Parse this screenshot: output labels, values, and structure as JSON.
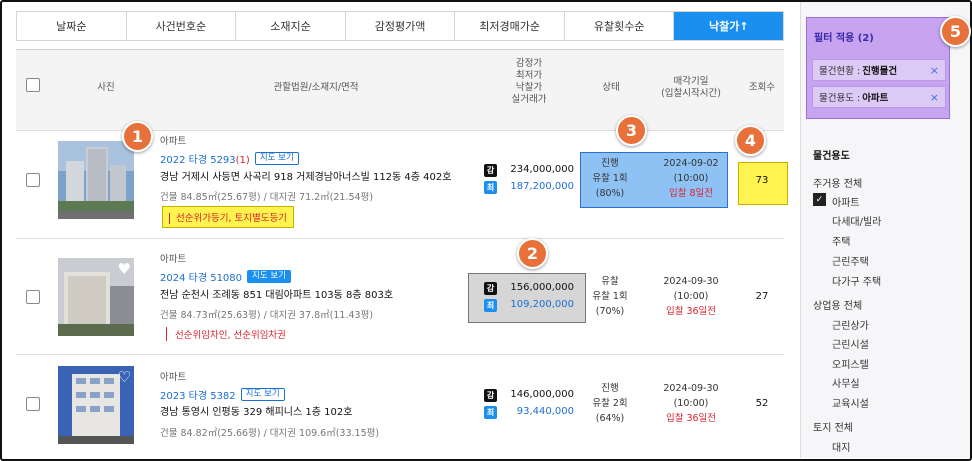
{
  "sort_tabs": [
    {
      "label": "날짜순",
      "active": false
    },
    {
      "label": "사건번호순",
      "active": false
    },
    {
      "label": "소재지순",
      "active": false
    },
    {
      "label": "감정평가액",
      "active": false
    },
    {
      "label": "최저경매가순",
      "active": false
    },
    {
      "label": "유찰횟수순",
      "active": false
    },
    {
      "label": "낙찰가↑",
      "active": true
    }
  ],
  "table_header": {
    "photo": "사진",
    "court": "관할법원/소재지/면적",
    "price_lines": [
      "감정가",
      "최저가",
      "낙찰가",
      "실거래가"
    ],
    "status": "상태",
    "sale_date_lines": [
      "매각기일",
      "(입찰시작시간)"
    ],
    "views": "조회수"
  },
  "rows": [
    {
      "type": "아파트",
      "case_no": "2022 타경 5293",
      "case_suffix": "(1)",
      "map_label": "지도 보기",
      "address": "경남 거제시 사등면 사곡리 918 거제경남아너스빌 112동 4층 402호",
      "area": "건물 84.85㎡(25.67평) / 대지권 71.2㎡(21.54평)",
      "warning": "선순위가등기, 토지별도등기",
      "chip_k": "감",
      "chip_c": "최",
      "appraised": "234,000,000",
      "minimum": "187,200,000",
      "status_lines": [
        "진행",
        "유찰 1회",
        "(80%)"
      ],
      "date": "2024-09-02",
      "time": "(10:00)",
      "dday": "입찰 8일전",
      "views": "73"
    },
    {
      "type": "아파트",
      "case_no": "2024 타경 51080",
      "case_suffix": "",
      "map_label": "지도 보기",
      "address": "전남 순천시 조례동 851 대림아파트 103동 8층 803호",
      "area": "건물 84.73㎡(25.63평) / 대지권 37.8㎡(11.43평)",
      "warning": "선순위임차인, 선순위임차권",
      "chip_k": "감",
      "chip_c": "최",
      "appraised": "156,000,000",
      "minimum": "109,200,000",
      "status_lines": [
        "유찰",
        "유찰 1회",
        "(70%)"
      ],
      "date": "2024-09-30",
      "time": "(10:00)",
      "dday": "입찰 36일전",
      "views": "27"
    },
    {
      "type": "아파트",
      "case_no": "2023 타경 5382",
      "case_suffix": "",
      "map_label": "지도 보기",
      "address": "경남 통영시 인평동 329 해피니스 1층 102호",
      "area": "건물 84.82㎡(25.66평) / 대지권 109.6㎡(33.15평)",
      "warning": "",
      "chip_k": "감",
      "chip_c": "최",
      "appraised": "146,000,000",
      "minimum": "93,440,000",
      "status_lines": [
        "진행",
        "유찰 2회",
        "(64%)"
      ],
      "date": "2024-09-30",
      "time": "(10:00)",
      "dday": "입찰 36일전",
      "views": "52"
    }
  ],
  "callouts": [
    "1",
    "2",
    "3",
    "4",
    "5"
  ],
  "sidebar": {
    "filter_title": "필터 적용 (2)",
    "filters": [
      {
        "label": "물건현황 :",
        "value": "진행물건",
        "close": "×"
      },
      {
        "label": "물건용도 :",
        "value": "아파트",
        "close": "×"
      }
    ],
    "section_title": "물건용도",
    "residential_all": "주거용 전체",
    "residential": [
      "아파트",
      "다세대/빌라",
      "주택",
      "근린주택",
      "다가구 주택"
    ],
    "commercial_all": "상업용 전체",
    "commercial": [
      "근린상가",
      "근린시설",
      "오피스텔",
      "사무실",
      "교육시설"
    ],
    "land_all": "토지 전체",
    "land": [
      "대지"
    ]
  },
  "colors": {
    "accent": "#1a8ff0",
    "link": "#1a6fd0",
    "warning": "#d9232e",
    "callout": "#e8703a",
    "highlight_yellow": "#fff44f",
    "highlight_purple": "#c7a3f0"
  }
}
